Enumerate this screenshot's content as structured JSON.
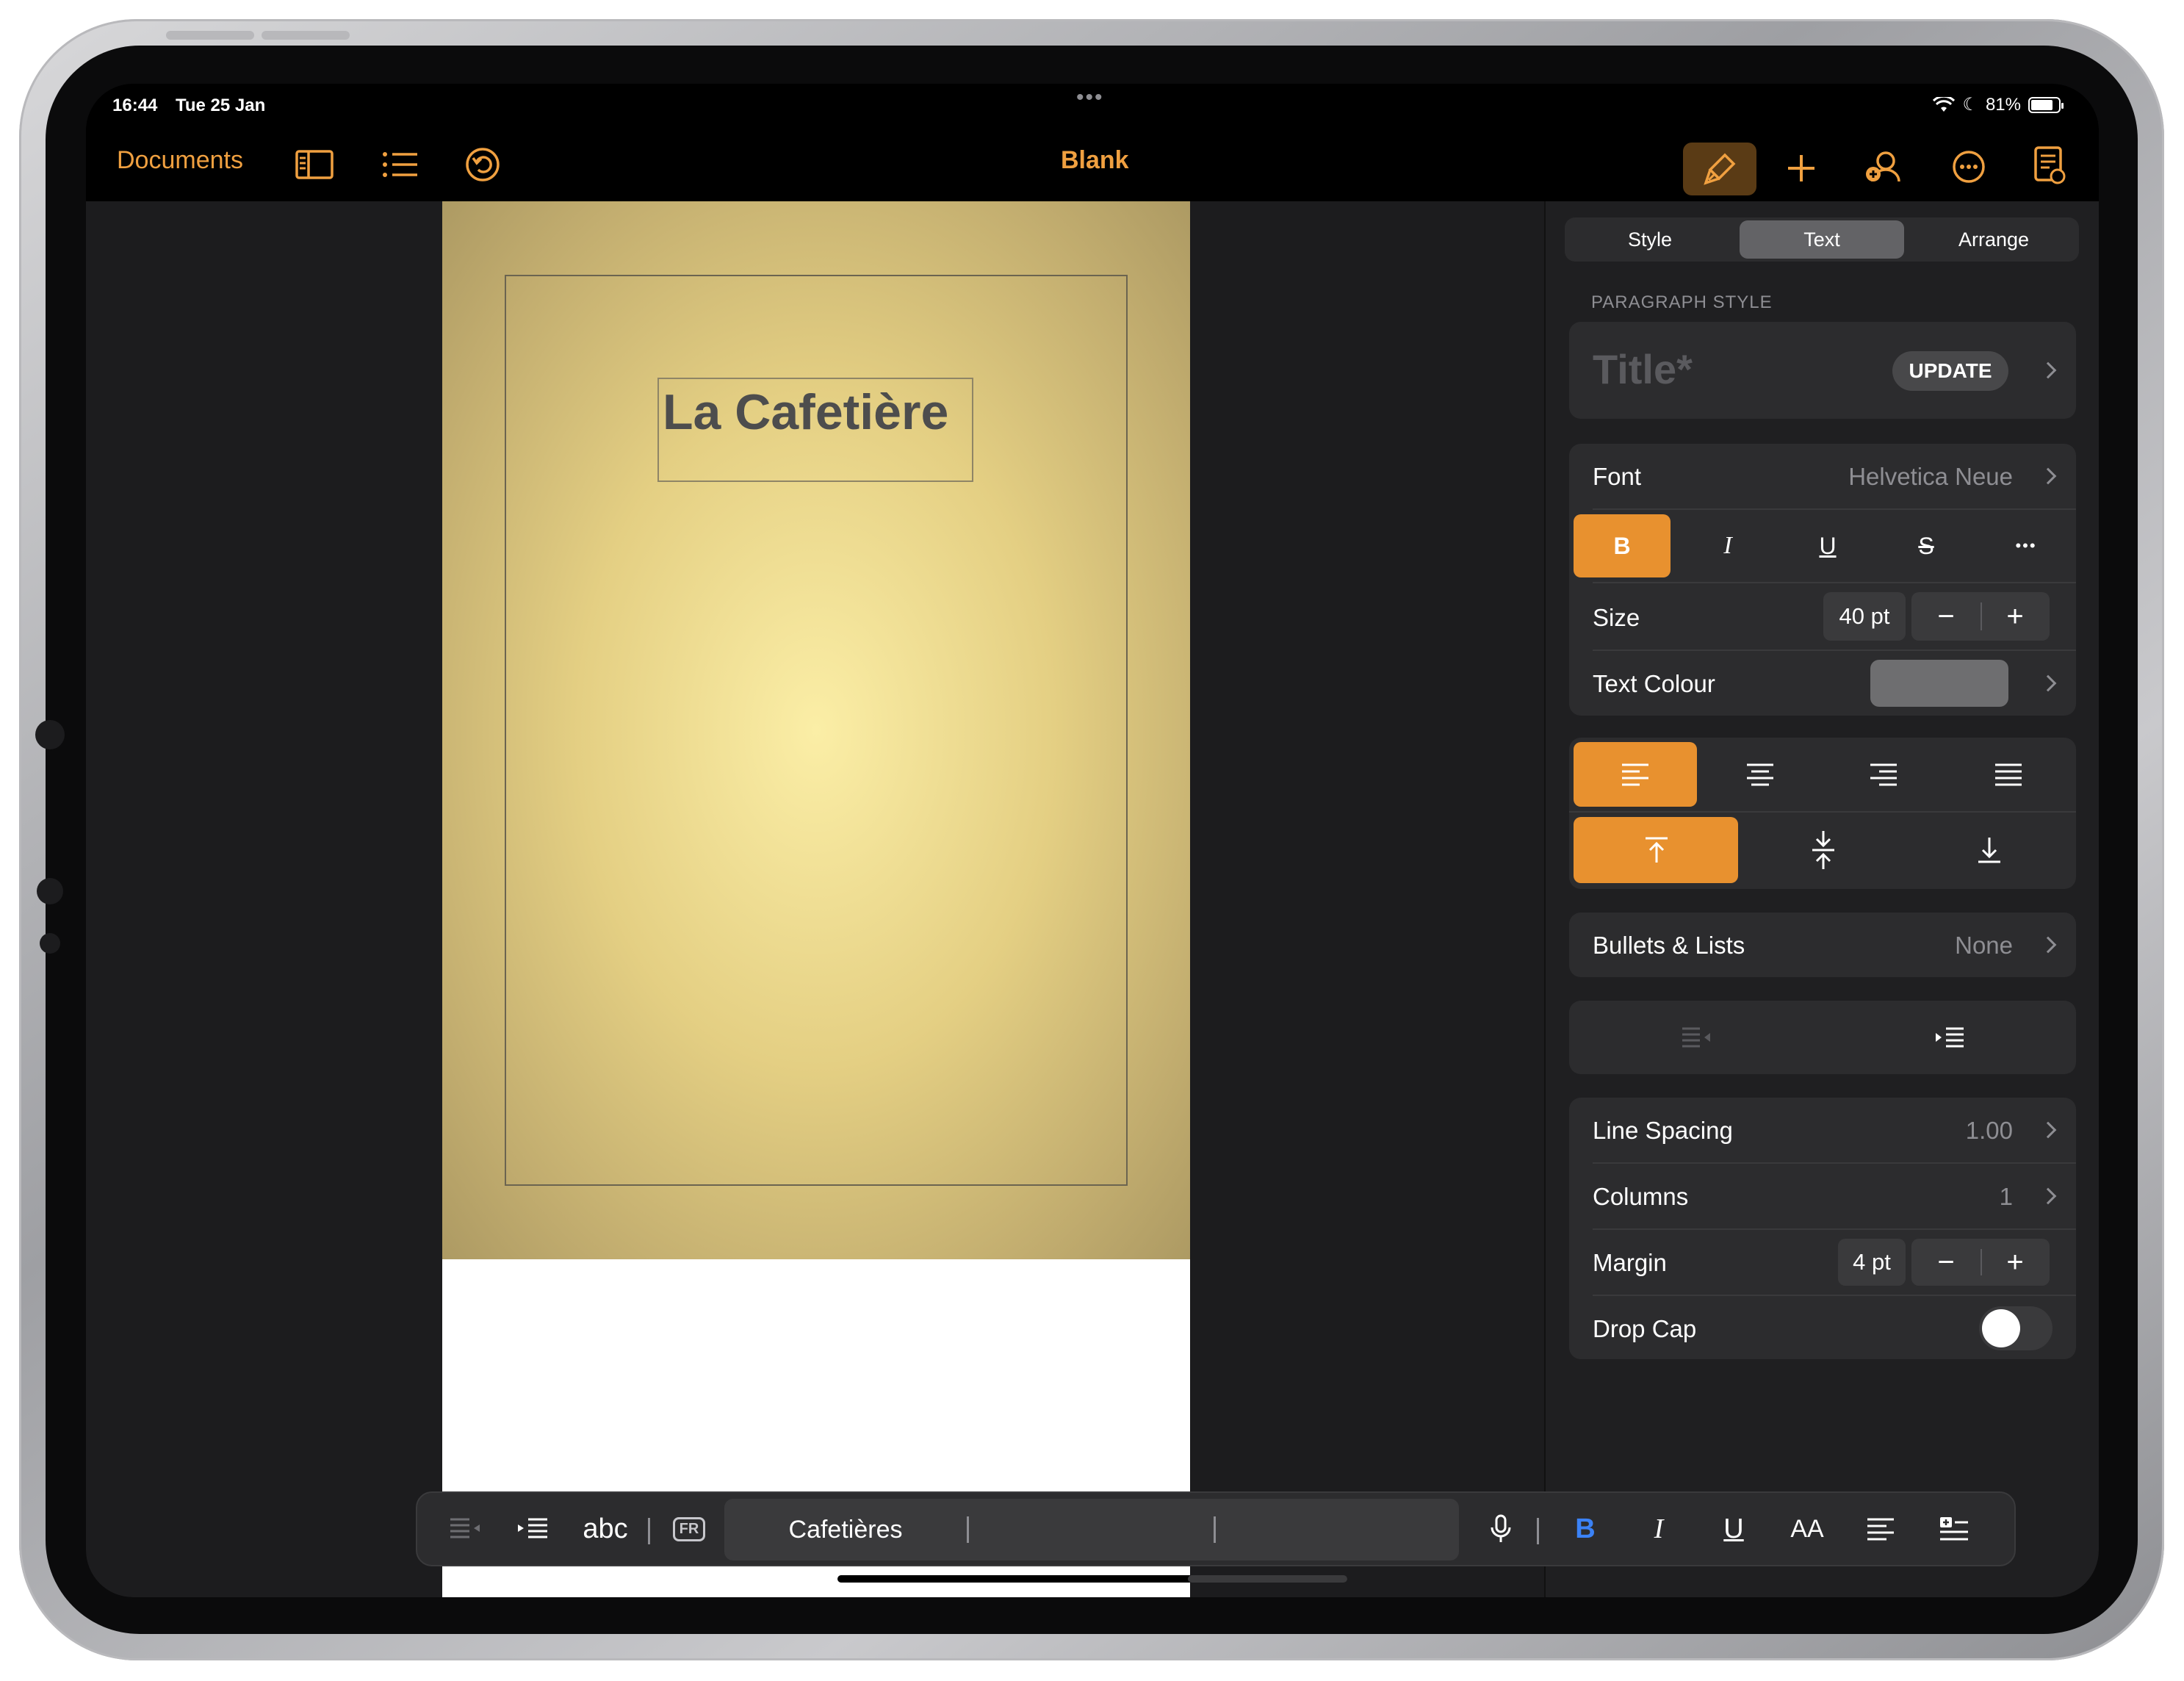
{
  "status": {
    "time": "16:44",
    "date": "Tue 25 Jan",
    "battery": "81%"
  },
  "toolbar": {
    "documents_label": "Documents",
    "title": "Blank"
  },
  "document": {
    "title_text": "La Cafetière"
  },
  "inspector": {
    "tabs": [
      "Style",
      "Text",
      "Arrange"
    ],
    "active_tab": "Text",
    "paragraph_style_label": "PARAGRAPH STYLE",
    "paragraph_style_value": "Title*",
    "update_label": "UPDATE",
    "font_label": "Font",
    "font_value": "Helvetica Neue",
    "style_buttons": {
      "bold": "B",
      "italic": "I",
      "underline": "U",
      "strike": "S",
      "more": "•••"
    },
    "size_label": "Size",
    "size_value": "40 pt",
    "text_colour_label": "Text Colour",
    "bullets_label": "Bullets & Lists",
    "bullets_value": "None",
    "line_spacing_label": "Line Spacing",
    "line_spacing_value": "1.00",
    "columns_label": "Columns",
    "columns_value": "1",
    "margin_label": "Margin",
    "margin_value": "4 pt",
    "drop_cap_label": "Drop Cap"
  },
  "shortcut_bar": {
    "abc_label": "abc",
    "lang_label": "FR",
    "suggestion": "Cafetières",
    "bold": "B",
    "italic": "I",
    "underline": "U",
    "text_size": "AA"
  },
  "colors": {
    "accent": "#e8912f",
    "text_colour_swatch": "#6e6e70"
  }
}
